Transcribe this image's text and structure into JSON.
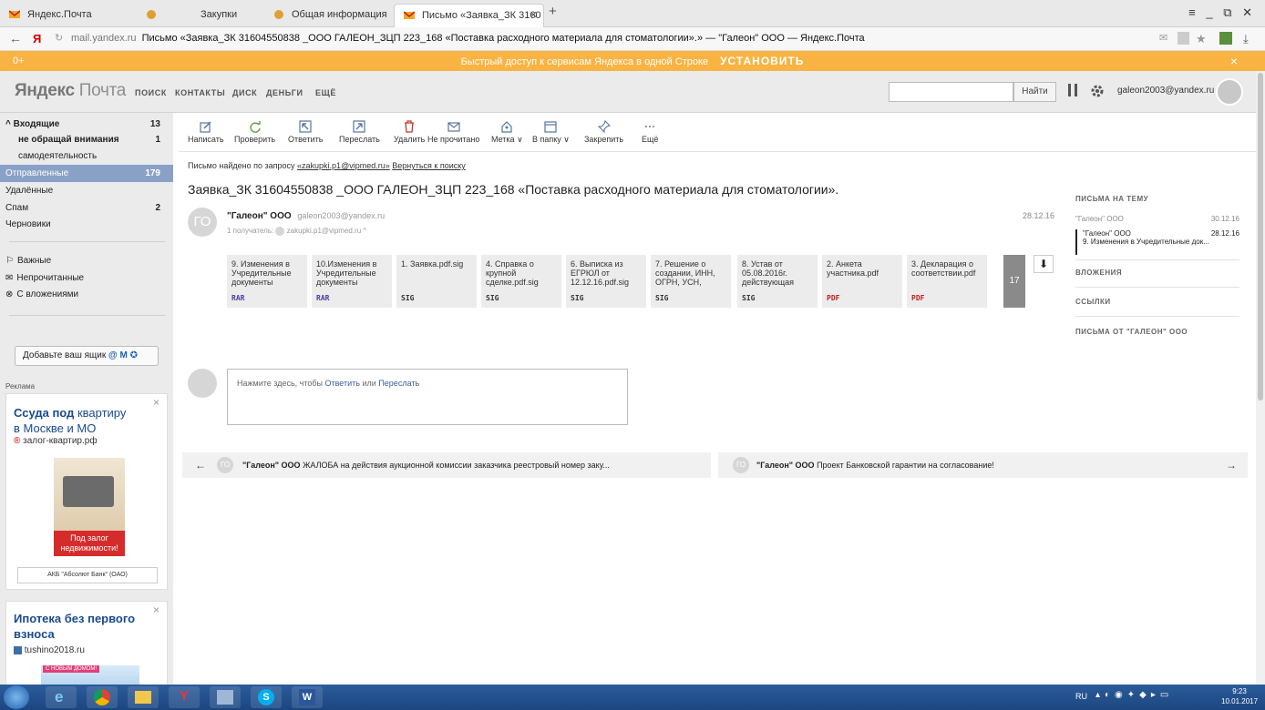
{
  "tabs": [
    {
      "label": "Яндекс.Почта"
    },
    {
      "label": ""
    },
    {
      "label": "Закупки"
    },
    {
      "label": "Общая информация"
    },
    {
      "label": "Письмо «Заявка_ЗК 3160"
    }
  ],
  "browser": {
    "url_domain": "mail.yandex.ru",
    "url_title": "Письмо «Заявка_ЗК 31604550838 _ООО ГАЛЕОН_ЗЦП 223_168 «Поставка расходного материала для стоматологии».» — \"Галеон\" ООО — Яндекс.Почта",
    "back_label": "←",
    "ya_label": "Я",
    "window_controls": "≡ _ ⧉ ✕"
  },
  "promo": {
    "counter": "0+",
    "text": "Быстрый доступ к сервисам Яндекса в одной Строке",
    "cta": "УСТАНОВИТЬ",
    "close": "×"
  },
  "header": {
    "logo_a": "Яндекс",
    "logo_b": "Почта",
    "nav": [
      "ПОИСК",
      "КОНТАКТЫ",
      "ДИСК",
      "ДЕНЬГИ",
      "ЕЩЁ"
    ],
    "search_button": "Найти",
    "user_email": "galeon2003@yandex.ru"
  },
  "sidebar": {
    "folders": [
      {
        "label": "^ Входящие",
        "count": "13"
      },
      {
        "label": "не обращай внимания",
        "count": "1"
      },
      {
        "label": "самодеятельность",
        "count": ""
      },
      {
        "label": "Отправленные",
        "count": "179"
      },
      {
        "label": "Удалённые",
        "count": ""
      },
      {
        "label": "Спам",
        "count": "2"
      },
      {
        "label": "Черновики",
        "count": ""
      }
    ],
    "filters": [
      {
        "label": "Важные"
      },
      {
        "label": "Непрочитанные"
      },
      {
        "label": "С вложениями"
      }
    ],
    "add_mailbox": "Добавьте ваш ящик",
    "ads_label": "Реклама",
    "ad1": {
      "title_a": "Ссуда под",
      "title_b": "квартиру",
      "title_c": "в Москве",
      "title_d": "и МО",
      "site": "залог-квартир.рф",
      "banner_text": "Под залог недвижимости!",
      "bank": "АКБ \"Абсолют Банк\" (ОАО)"
    },
    "ad2": {
      "title": "Ипотека без первого взноса",
      "site": "tushino2018.ru",
      "banner_text": "С НОВЫМ ДОМОМ!"
    }
  },
  "toolbar": [
    {
      "label": "Написать",
      "icon": "pencil-icon"
    },
    {
      "label": "Проверить",
      "icon": "refresh-icon"
    },
    {
      "label": "Ответить",
      "icon": "reply-icon"
    },
    {
      "label": "Переслать",
      "icon": "forward-icon"
    },
    {
      "label": "Удалить",
      "icon": "trash-icon"
    },
    {
      "label": "Не прочитано",
      "icon": "envelope-icon"
    },
    {
      "label": "Метка ∨",
      "icon": "tag-icon"
    },
    {
      "label": "В папку ∨",
      "icon": "folder-icon"
    },
    {
      "label": "Закрепить",
      "icon": "pin-icon"
    },
    {
      "label": "Ещё",
      "icon": "more-icon"
    }
  ],
  "message": {
    "found_prefix": "Письмо найдено по запросу",
    "found_query": "«zakupki.p1@vipmed.ru»",
    "back_to_search": "Вернуться к поиску",
    "subject": "Заявка_ЗК 31604550838 _ООО ГАЛЕОН_ЗЦП 223_168 «Поставка расходного материала для стоматологии».",
    "sender_name": "\"Галеон\" ООО",
    "sender_email": "galeon2003@yandex.ru",
    "recipients_label": "1 получатель:",
    "recipient": "zakupki.p1@vipmed.ru",
    "date": "28.12.16",
    "avatar_initials": "ГО"
  },
  "attachments": [
    {
      "name": "9. Изменения в Учредительные документы",
      "type": "RAR",
      "color": "#4a3da1"
    },
    {
      "name": "10.Изменения в Учредительные документы",
      "type": "RAR",
      "color": "#4a3da1"
    },
    {
      "name": "1. Заявка.pdf.sig",
      "type": "SIG",
      "color": "#222"
    },
    {
      "name": "4. Справка о крупной сделке.pdf.sig",
      "type": "SIG",
      "color": "#222"
    },
    {
      "name": "6. Выписка из ЕГРЮЛ от 12.12.16.pdf.sig",
      "type": "SIG",
      "color": "#222"
    },
    {
      "name": "7. Решение о создании, ИНН, ОГРН, УСН,",
      "type": "SIG",
      "color": "#222"
    },
    {
      "name": "8. Устав от 05.08.2016г. действующая",
      "type": "SIG",
      "color": "#222"
    },
    {
      "name": "2. Анкета участника.pdf",
      "type": "PDF",
      "color": "#c0201f"
    },
    {
      "name": "3. Декларация о соответствии.pdf",
      "type": "PDF",
      "color": "#c0201f"
    }
  ],
  "attachments_more": "17",
  "reply": {
    "prefix": "Нажмите здесь, чтобы",
    "reply_link": "Ответить",
    "or": "или",
    "forward_link": "Переслать"
  },
  "prev": {
    "sender": "\"Галеон\" ООО",
    "subject": "ЖАЛОБА на действия аукционной комиссии заказчика реестровый номер заку..."
  },
  "next": {
    "sender": "\"Галеон\" ООО",
    "subject": "Проект Банковской гарантии на согласование!"
  },
  "right_panel": {
    "thread_title": "ПИСЬМА НА ТЕМУ",
    "thread": [
      {
        "sender": "\"Галеон\" ООО",
        "date": "30.12.16",
        "subject": ""
      },
      {
        "sender": "\"Галеон\" ООО",
        "date": "28.12.16",
        "subject": "9. Изменения в Учредительные док..."
      }
    ],
    "attachments_title": "ВЛОЖЕНИЯ",
    "links_title": "ССЫЛКИ",
    "from_title": "ПИСЬМА ОТ \"ГАЛЕОН\" ООО"
  },
  "taskbar": {
    "lang": "RU",
    "time": "9:23",
    "date": "10.01.2017"
  },
  "colors": {
    "promo": "#f9b342",
    "selected_folder": "#8aa1c7",
    "link": "#3b5e9e"
  }
}
